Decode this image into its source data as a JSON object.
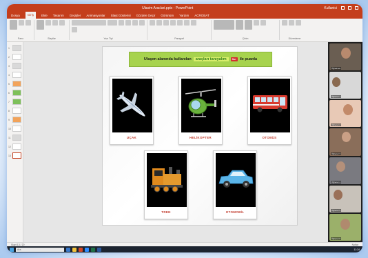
{
  "window": {
    "title": "Ulasim Araclari.pptx - PowerPoint",
    "user": "Kullanici"
  },
  "ribbon": {
    "tabs": [
      "Dosya",
      "Giriş",
      "Ekle",
      "Tasarım",
      "Geçişler",
      "Animasyonlar",
      "Slayt Gösterisi",
      "Gözden Geçir",
      "Görünüm",
      "Yardım",
      "ACROBAT"
    ],
    "active_tab": "Giriş",
    "groups": [
      "Pano",
      "Slaytlar",
      "Yazı Tipi",
      "Paragraf",
      "Çizim",
      "Düzenleme"
    ]
  },
  "slide_panel": {
    "numbers": [
      "1",
      "2",
      "3",
      "4",
      "5",
      "6",
      "7",
      "8",
      "9",
      "10",
      "11",
      "12",
      "13"
    ]
  },
  "slide": {
    "instruction_prefix": "Ulaşım alanında kullanılan",
    "instruction_highlight": "araçları tanıyalım",
    "instruction_stop": "Dur",
    "instruction_suffix": "ile puanla",
    "cards": [
      {
        "label": "UÇAK",
        "icon": "airplane-icon"
      },
      {
        "label": "HELİKOPTER",
        "icon": "helicopter-icon"
      },
      {
        "label": "OTOBÜS",
        "icon": "bus-icon"
      },
      {
        "label": "TREN",
        "icon": "train-icon"
      },
      {
        "label": "OTOMOBİL",
        "icon": "car-icon"
      }
    ]
  },
  "notes": {
    "placeholder": "Not eklemek için tıklayın"
  },
  "participants": [
    {
      "name": "Öğretmen"
    },
    {
      "name": "Öğrenci 1"
    },
    {
      "name": "Öğrenci 2"
    },
    {
      "name": "Öğrenci 3"
    },
    {
      "name": "Öğrenci 4"
    },
    {
      "name": "Öğrenci 5"
    },
    {
      "name": "Öğrenci 6"
    }
  ],
  "statusbar": {
    "left": "Slayt 13 / 20",
    "right": "Notlar"
  },
  "taskbar": {
    "search_placeholder": "Ara",
    "clock": "11:24"
  },
  "colors": {
    "accent": "#c43e1c",
    "instruction_bg": "#a7d34e",
    "label_red": "#c0392b"
  }
}
